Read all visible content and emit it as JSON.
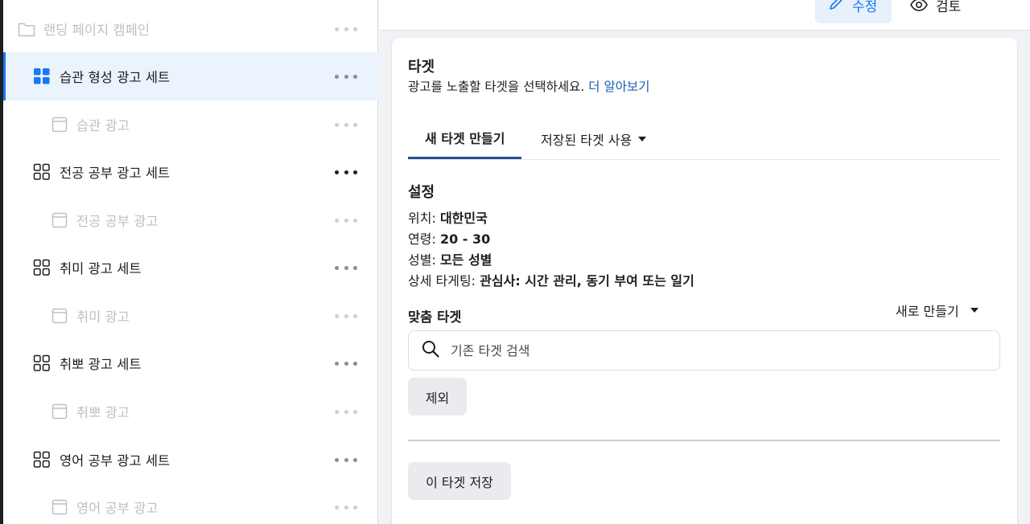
{
  "sidebar": {
    "items": [
      {
        "type": "campaign",
        "label": "랜딩 페이지 캠페인",
        "icon": "folder-icon"
      },
      {
        "type": "adset",
        "label": "습관 형성 광고 세트",
        "icon": "adset-grid-icon",
        "selected": true
      },
      {
        "type": "ad",
        "label": "습관 광고",
        "icon": "ad-icon"
      },
      {
        "type": "adset",
        "label": "전공 공부 광고 세트",
        "icon": "adset-grid-icon"
      },
      {
        "type": "ad",
        "label": "전공 공부 광고",
        "icon": "ad-icon"
      },
      {
        "type": "adset",
        "label": "취미 광고 세트",
        "icon": "adset-grid-icon"
      },
      {
        "type": "ad",
        "label": "취미 광고",
        "icon": "ad-icon"
      },
      {
        "type": "adset",
        "label": "취뽀 광고 세트",
        "icon": "adset-grid-icon"
      },
      {
        "type": "ad",
        "label": "취뽀 광고",
        "icon": "ad-icon"
      },
      {
        "type": "adset",
        "label": "영어 공부 광고 세트",
        "icon": "adset-grid-icon"
      },
      {
        "type": "ad",
        "label": "영어 공부 광고",
        "icon": "ad-icon"
      }
    ]
  },
  "toolbar": {
    "edit_label": "수정",
    "review_label": "검토"
  },
  "target": {
    "title": "타겟",
    "subtitle": "광고를 노출할 타겟을 선택하세요.",
    "learn_more": "더 알아보기",
    "tabs": {
      "new": "새 타겟 만들기",
      "saved": "저장된 타겟 사용"
    }
  },
  "settings": {
    "title": "설정",
    "location": {
      "label": "위치:",
      "value": "대한민국"
    },
    "age": {
      "label": "연령:",
      "value": "20 - 30"
    },
    "gender": {
      "label": "성별:",
      "value": "모든 성별"
    },
    "detailed": {
      "label": "상세 타게팅:",
      "value": "관심사: 시간 관리, 동기 부여 또는 일기"
    }
  },
  "custom_audience": {
    "title": "맞춤 타겟",
    "create_new": "새로 만들기",
    "search_placeholder": "기존 타겟 검색",
    "exclude_label": "제외"
  },
  "save_button": "이 타겟 저장",
  "colors": {
    "accent": "#1877f2",
    "link": "#1a5cb6",
    "selected_bg": "#ebf3fc",
    "tab_underline": "#2b4d8f"
  }
}
